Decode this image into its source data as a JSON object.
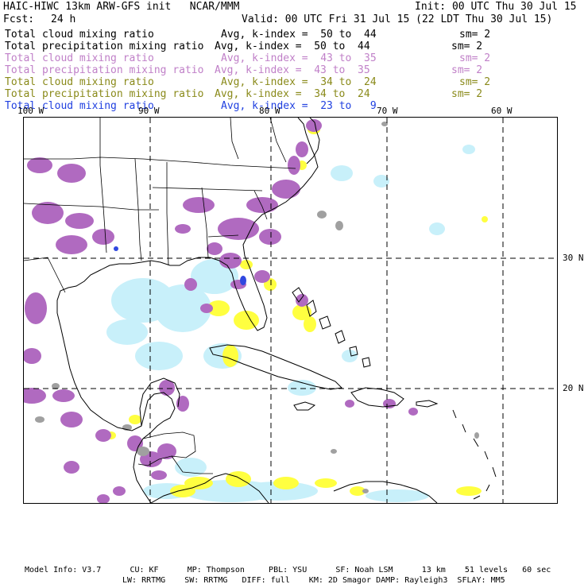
{
  "header": {
    "title": "HAIC-HIWC 13km ARW-GFS init   NCAR/MMM",
    "init": "Init: 00 UTC Thu 30 Jul 15",
    "fcst_label": "Fcst:",
    "fcst_value": "24 h",
    "valid": "Valid: 00 UTC Fri 31 Jul 15 (22 LDT Thu 30 Jul 15)"
  },
  "legend": [
    {
      "field": "Total cloud mixing ratio",
      "stat": "Avg, k-index =  50 to  44",
      "sm": "sm= 2",
      "color": "#000000"
    },
    {
      "field": "Total precipitation mixing ratio",
      "stat": "Avg, k-index =  50 to  44",
      "sm": "sm= 2",
      "color": "#000000"
    },
    {
      "field": "Total cloud mixing ratio",
      "stat": "Avg, k-index =  43 to  35",
      "sm": "sm= 2",
      "color": "#c080c8"
    },
    {
      "field": "Total precipitation mixing ratio",
      "stat": "Avg, k-index =  43 to  35",
      "sm": "sm= 2",
      "color": "#c080c8"
    },
    {
      "field": "Total cloud mixing ratio",
      "stat": "Avg, k-index =  34 to  24",
      "sm": "sm= 2",
      "color": "#8a8a1a"
    },
    {
      "field": "Total precipitation mixing ratio",
      "stat": "Avg, k-index =  34 to  24",
      "sm": "sm= 2",
      "color": "#8a8a1a"
    },
    {
      "field": "Total cloud mixing ratio",
      "stat": "Avg, k-index =  23 to   9",
      "sm": "",
      "color": "#2040e0"
    }
  ],
  "map": {
    "lon_labels": [
      "100 W",
      "90 W",
      "80 W",
      "70 W",
      "60 W"
    ],
    "lat_labels": [
      "30 N",
      "20 N"
    ],
    "colors": {
      "purple": "#b06ac0",
      "yellow": "#ffff40",
      "lightblue": "#c8f0fa",
      "blue": "#3048e0",
      "gray": "#a0a0a0"
    }
  },
  "footer": {
    "line1": "Model Info: V3.7      CU: KF      MP: Thompson     PBL: YSU      SF: Noah LSM      13 km    51 levels   60 sec",
    "line2": "LW: RRTMG    SW: RRTMG   DIFF: full    KM: 2D Smagor DAMP: Rayleigh3  SFLAY: MM5"
  }
}
